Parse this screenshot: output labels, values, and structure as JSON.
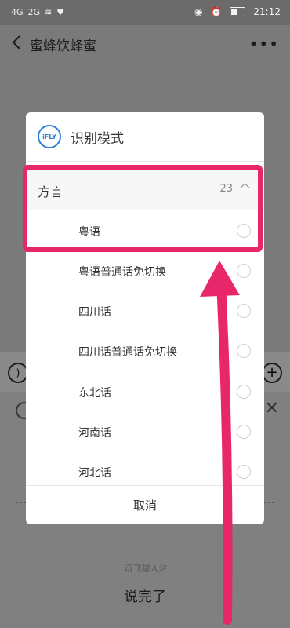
{
  "status_bar": {
    "left_indicators": [
      "4G",
      "2G",
      "wifi"
    ],
    "time": "21:12"
  },
  "header": {
    "title": "蜜蜂饮蜂蜜",
    "more_icon": "more-dots-icon",
    "back_icon": "chevron-left-icon"
  },
  "dialog": {
    "logo_text": "iFLY",
    "title": "识别模式",
    "group": {
      "label": "方言",
      "count": "23"
    },
    "options": [
      {
        "label": "粤语"
      },
      {
        "label": "粤语普通话免切换"
      },
      {
        "label": "四川话"
      },
      {
        "label": "四川话普通话免切换"
      },
      {
        "label": "东北话"
      },
      {
        "label": "河南话"
      },
      {
        "label": "河北话"
      }
    ],
    "cancel_label": "取消"
  },
  "background": {
    "ime_brand": "讯飞输入法",
    "done_label": "说完了"
  },
  "annotation": {
    "accent_color": "#e8276a"
  }
}
